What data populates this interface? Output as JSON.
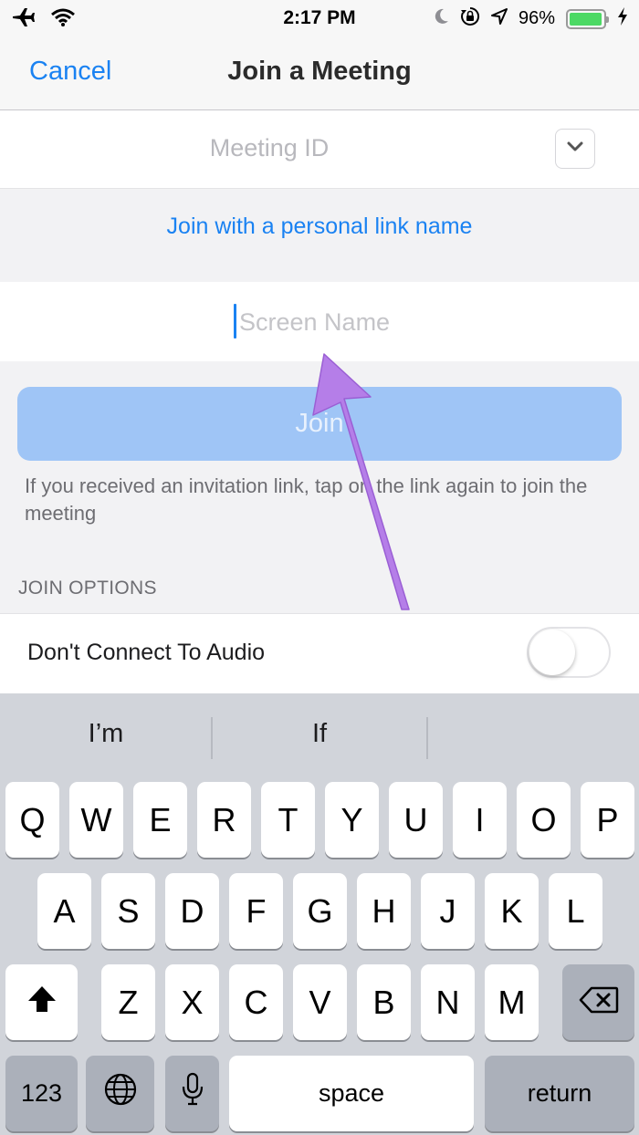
{
  "status_bar": {
    "time": "2:17 PM",
    "battery_percent": "96%",
    "battery_level": 0.96,
    "icons": [
      "airplane-icon",
      "wifi-icon",
      "moon-icon",
      "orientation-lock-icon",
      "location-icon",
      "battery-icon",
      "charging-icon"
    ]
  },
  "nav": {
    "cancel_label": "Cancel",
    "title": "Join a Meeting"
  },
  "form": {
    "meeting_id_placeholder": "Meeting ID",
    "personal_link_label": "Join with a personal link name",
    "screen_name_placeholder": "Screen Name",
    "join_button_label": "Join",
    "hint": "If you received an invitation link, tap on the link again to join the meeting"
  },
  "join_options": {
    "header": "JOIN OPTIONS",
    "audio_label": "Don't Connect To Audio",
    "audio_toggle_on": false
  },
  "keyboard": {
    "suggestions": [
      "I’m",
      "If",
      ""
    ],
    "row1": [
      "Q",
      "W",
      "E",
      "R",
      "T",
      "Y",
      "U",
      "I",
      "O",
      "P"
    ],
    "row2": [
      "A",
      "S",
      "D",
      "F",
      "G",
      "H",
      "J",
      "K",
      "L"
    ],
    "row3": [
      "Z",
      "X",
      "C",
      "V",
      "B",
      "N",
      "M"
    ],
    "numbers_label": "123",
    "space_label": "space",
    "return_label": "return"
  },
  "colors": {
    "accent": "#1a82f2",
    "annotation_arrow": "#b57ee8"
  }
}
